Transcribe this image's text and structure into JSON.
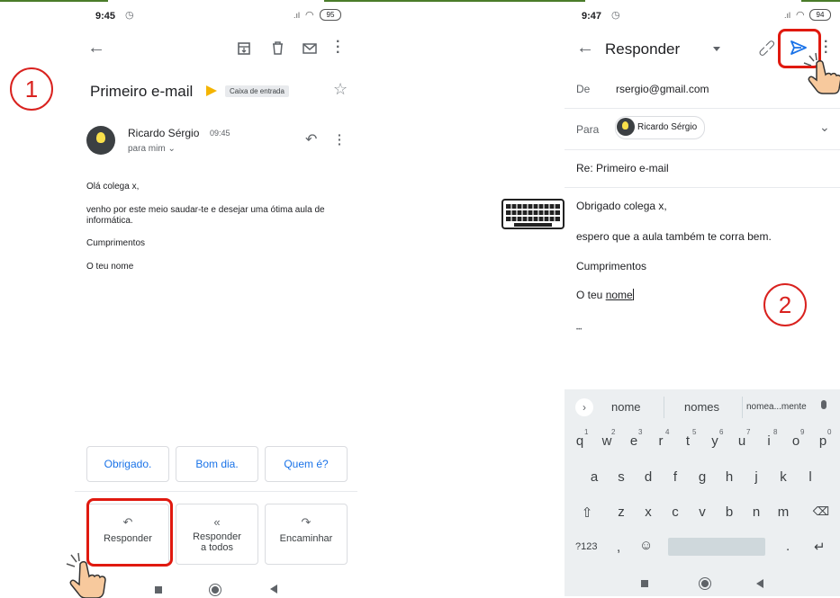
{
  "markers": {
    "step1": "1",
    "step2": "2"
  },
  "colors": {
    "accent": "#1a73e8",
    "highlight": "#e0190f",
    "important": "#f4b400",
    "keyboard_bg": "#eceff1"
  },
  "left": {
    "status": {
      "time": "9:45",
      "battery": "95"
    },
    "subject": "Primeiro e-mail",
    "label_chip": "Caixa de entrada",
    "sender": {
      "name": "Ricardo Sérgio",
      "time": "09:45",
      "recipient": "para mim"
    },
    "body": [
      "Olá colega x,",
      "venho por este meio saudar-te e desejar uma ótima aula de informática.",
      "Cumprimentos",
      "O teu nome"
    ],
    "smart_replies": [
      "Obrigado.",
      "Bom dia.",
      "Quem é?"
    ],
    "actions": {
      "reply": "Responder",
      "reply_all": "Responder a todos",
      "forward": "Encaminhar"
    }
  },
  "right": {
    "status": {
      "time": "9:47",
      "battery": "94"
    },
    "title": "Responder",
    "from_label": "De",
    "from_value": "rsergio@gmail.com",
    "to_label": "Para",
    "to_chip": "Ricardo Sérgio",
    "subject": "Re: Primeiro e-mail",
    "body": {
      "line1": "Obrigado colega x,",
      "line2": "espero que a aula também te corra bem.",
      "line3": "Cumprimentos",
      "line4_a": "O teu ",
      "line4_b": "nome"
    },
    "ellipsis": "•••",
    "suggestions": [
      "nome",
      "nomes",
      "nomea...mente"
    ],
    "keyboard": {
      "row1": [
        "q",
        "w",
        "e",
        "r",
        "t",
        "y",
        "u",
        "i",
        "o",
        "p"
      ],
      "row1_nums": [
        "1",
        "2",
        "3",
        "4",
        "5",
        "6",
        "7",
        "8",
        "9",
        "0"
      ],
      "row2": [
        "a",
        "s",
        "d",
        "f",
        "g",
        "h",
        "j",
        "k",
        "l"
      ],
      "row3": [
        "z",
        "x",
        "c",
        "v",
        "b",
        "n",
        "m"
      ],
      "sym_key": "?123",
      "comma": ",",
      "period": "."
    }
  }
}
